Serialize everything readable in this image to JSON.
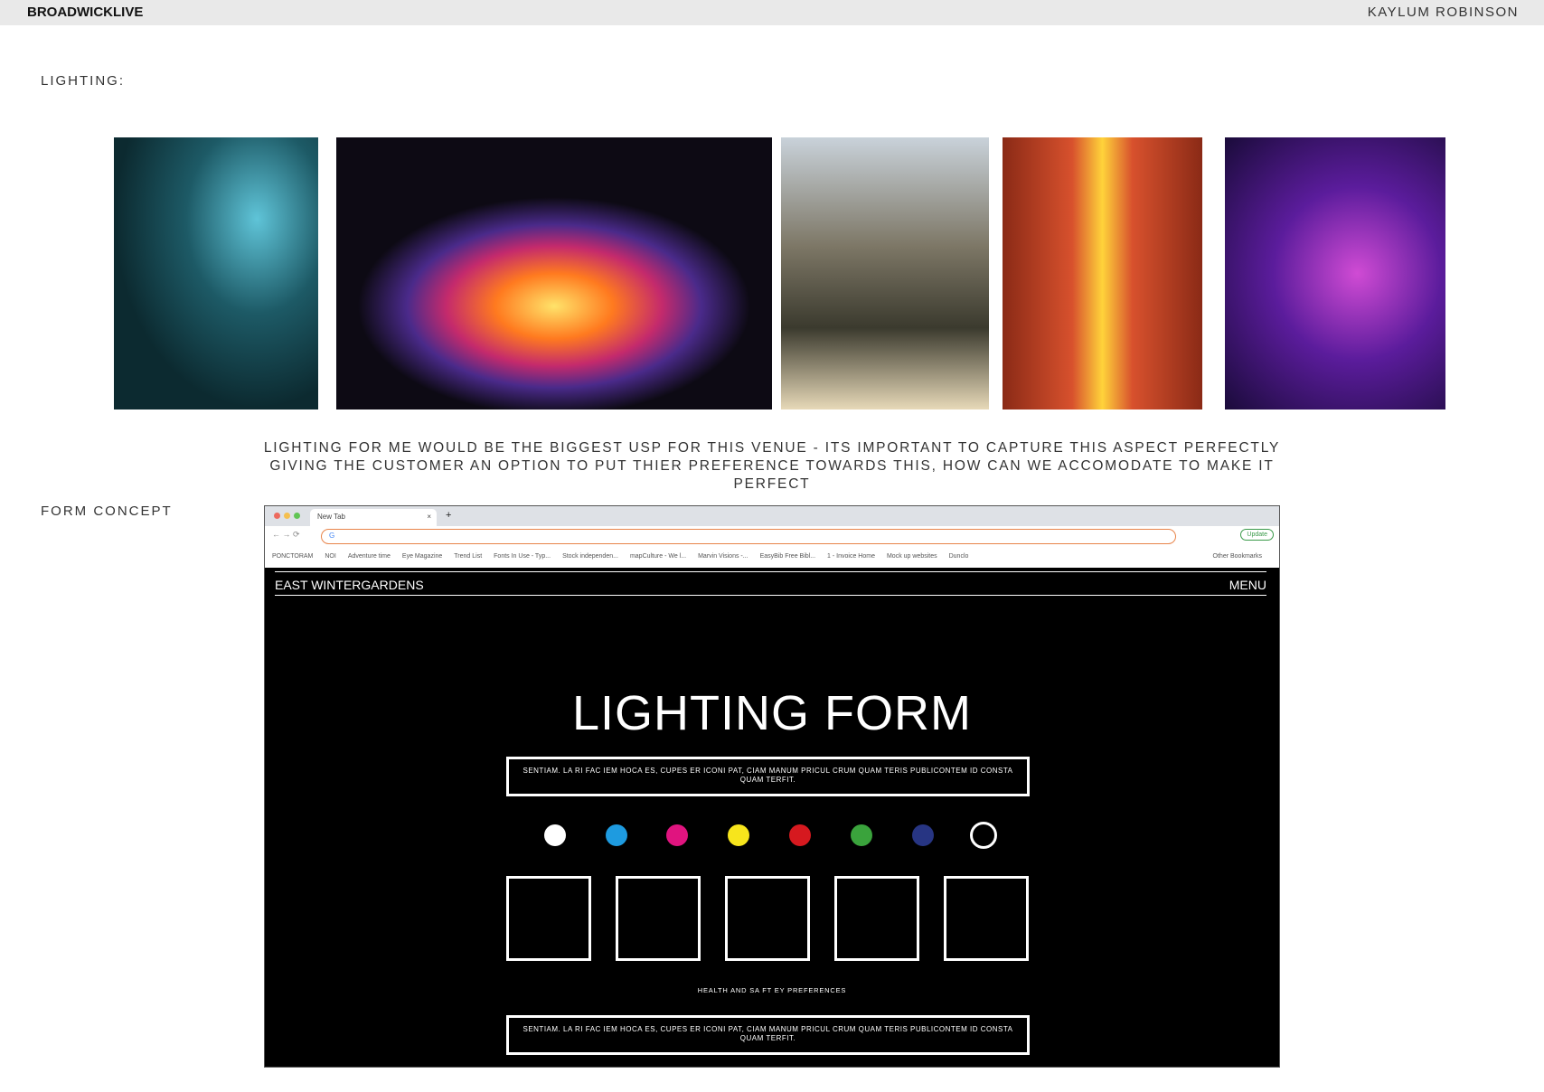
{
  "header": {
    "brand": "BROADWICKLIVE",
    "author": "KAYLUM ROBINSON"
  },
  "sections": {
    "lighting": "LIGHTING:",
    "form_concept": "FORM CONCEPT"
  },
  "description": "LIGHTING FOR ME WOULD BE THE BIGGEST USP FOR THIS VENUE - ITS IMPORTANT TO CAPTURE THIS ASPECT PERFECTLY GIVING THE CUSTOMER AN OPTION TO PUT THIER PREFERENCE TOWARDS THIS, HOW CAN WE ACCOMODATE TO MAKE IT PERFECT",
  "browser": {
    "tab": "New Tab",
    "url": "G",
    "update": "Update",
    "bookmarks": [
      "PONCTORAM",
      "NOI",
      "Adventure time",
      "Eye Magazine",
      "Trend List",
      "Fonts In Use - Typ...",
      "Stock independen...",
      "mapCulture - We l...",
      "Marvin Visions -...",
      "EasyBib Free Bibl...",
      "1 - Invoice Home",
      "Mock up websites",
      "Dunclo"
    ],
    "other_bookmarks": "Other Bookmarks"
  },
  "site": {
    "name": "EAST WINTERGARDENS",
    "menu": "MENU",
    "title": "LIGHTING FORM",
    "box_text": "SENTIAM. LA RI FAC IEM HOCA ES, CUPES ER ICONI PAT, CIAM MANUM PRICUL CRUM QUAM TERIS PUBLICONTEM ID CONSTA QUAM TERFIT.",
    "health_label": "HEALTH AND SA FT EY PREFERENCES",
    "box2_text": "SENTIAM. LA RI FAC IEM HOCA ES, CUPES ER ICONI PAT, CIAM MANUM PRICUL CRUM QUAM TERIS PUBLICONTEM ID CONSTA QUAM TERFIT.",
    "colors": [
      "#ffffff",
      "#1e9be0",
      "#e0147f",
      "#f7e51c",
      "#d6191f",
      "#3aa33c",
      "#273583",
      "none"
    ]
  }
}
